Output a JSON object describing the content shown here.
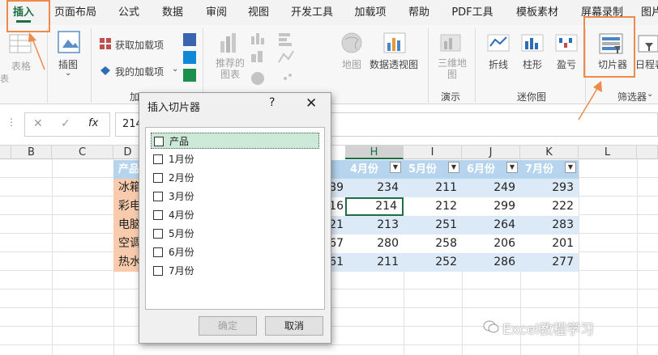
{
  "tabs": [
    "插入",
    "页面布局",
    "公式",
    "数据",
    "审阅",
    "视图",
    "开发工具",
    "加载项",
    "帮助",
    "PDF工具",
    "模板素材",
    "屏幕录制",
    "图片"
  ],
  "ribbon": {
    "tables_label": "表格",
    "illustrations_label": "插图",
    "get_addins": "获取加载项",
    "my_addins": "我的加载项",
    "addins_group_partial": "加",
    "recommended_charts": "推荐的\n图表",
    "maps_label": "地图",
    "pivot_chart_label": "数据透视图",
    "threed_map_label": "三维地\n图",
    "tours_group": "演示",
    "sparkline_line": "折线",
    "sparkline_column": "柱形",
    "sparkline_winloss": "盈亏",
    "sparkline_group": "迷你图",
    "slicer_label": "切片器",
    "timeline_partial": "日程表",
    "filters_group": "筛选器",
    "edge_partial": "表"
  },
  "formula_bar": {
    "cancel_symbol": "✕",
    "enter_symbol": "✓",
    "fx_symbol": "fx",
    "value": "214"
  },
  "columns": [
    "B",
    "C",
    "D",
    "H",
    "I",
    "J",
    "K",
    "L"
  ],
  "table": {
    "header_partial": "产品",
    "headers": [
      "4月份",
      "5月份",
      "6月份",
      "7月份"
    ],
    "rows": [
      {
        "product": "冰箱",
        "g": "89",
        "h": "234",
        "i": "211",
        "j": "249",
        "k": "293"
      },
      {
        "product": "彩电",
        "g": "16",
        "h": "214",
        "i": "212",
        "j": "299",
        "k": "222"
      },
      {
        "product": "电脑",
        "g": "21",
        "h": "213",
        "i": "251",
        "j": "264",
        "k": "283"
      },
      {
        "product": "空调",
        "g": "67",
        "h": "280",
        "i": "258",
        "j": "206",
        "k": "201"
      },
      {
        "product": "热水",
        "g": "61",
        "h": "211",
        "i": "252",
        "j": "286",
        "k": "277"
      }
    ]
  },
  "dialog": {
    "title": "插入切片器",
    "help": "?",
    "close": "✕",
    "items": [
      "产品",
      "1月份",
      "2月份",
      "3月份",
      "4月份",
      "5月份",
      "6月份",
      "7月份"
    ],
    "ok": "确定",
    "cancel": "取消"
  },
  "watermark": "Excel教程学习",
  "colors": {
    "accent": "#1f6e43",
    "annotation": "#f08a4b",
    "table_header": "#b6d4ee",
    "table_band": "#dce9f6"
  }
}
